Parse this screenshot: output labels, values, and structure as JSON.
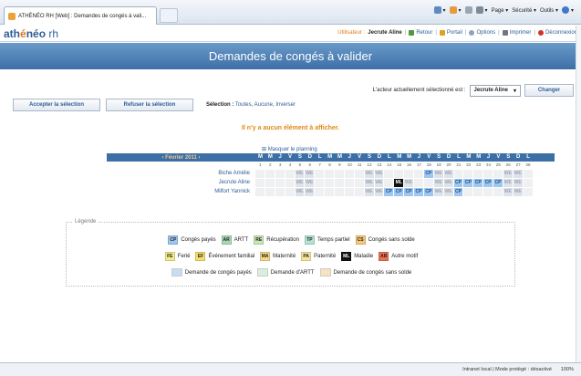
{
  "browser": {
    "tab_title": "ATHÉNÉO RH [Web] : Demandes de congés à vali...",
    "commands": [
      "Page ▾",
      "Sécurité ▾",
      "Outils ▾"
    ]
  },
  "header": {
    "logo_a": "ath",
    "logo_o": "é",
    "logo_b": "néo",
    "logo_rh": "rh",
    "user_label": "Utilisateur :",
    "user_name": "Jecrute Aline",
    "links": [
      "Retour",
      "Portail",
      "Options",
      "Imprimer",
      "Déconnexion"
    ]
  },
  "page": {
    "title": "Demandes de congés à valider",
    "actor_label": "L'acteur actuellement sélectionné est :",
    "actor_value": "Jecrute Aline",
    "change_label": "Changer",
    "accept_label": "Accepter la sélection",
    "refuse_label": "Refuser la sélection",
    "selection_label": "Sélection :",
    "selection_links": [
      "Toutes",
      "Aucune",
      "Inverser"
    ],
    "empty_message": "Il n'y a aucun élément à afficher.",
    "hide_planning": "⊞ Masquer le planning"
  },
  "planning": {
    "month": "‹ Février 2011 ›",
    "days_of_week": [
      "M",
      "M",
      "J",
      "V",
      "S",
      "D",
      "L",
      "M",
      "M",
      "J",
      "V",
      "S",
      "D",
      "L",
      "M",
      "M",
      "J",
      "V",
      "S",
      "D",
      "L",
      "M",
      "M",
      "J",
      "V",
      "S",
      "D",
      "L"
    ],
    "day_numbers": [
      "1",
      "2",
      "3",
      "4",
      "5",
      "6",
      "7",
      "8",
      "9",
      "10",
      "11",
      "12",
      "13",
      "14",
      "15",
      "16",
      "17",
      "18",
      "19",
      "20",
      "21",
      "22",
      "23",
      "24",
      "25",
      "26",
      "27",
      "28"
    ],
    "rows": [
      {
        "name": "Biche Amélie",
        "cells": [
          "",
          "",
          "",
          "",
          "WE",
          "WE",
          "",
          "",
          "",
          "",
          "",
          "WE",
          "WE",
          "",
          "",
          "",
          "",
          "CP",
          "WE",
          "WE",
          "",
          "",
          "",
          "",
          "",
          "WE",
          "WE",
          ""
        ]
      },
      {
        "name": "Jecrute Aline",
        "cells": [
          "",
          "",
          "",
          "",
          "WE",
          "WE",
          "",
          "",
          "",
          "",
          "",
          "WE",
          "WE",
          "",
          "ML",
          "WE",
          "",
          "",
          "WE",
          "WE",
          "CP",
          "CP",
          "CP",
          "CP",
          "CP",
          "WE",
          "WE",
          ""
        ]
      },
      {
        "name": "Milfort Yannick",
        "cells": [
          "",
          "",
          "",
          "",
          "WE",
          "WE",
          "",
          "",
          "",
          "",
          "",
          "WE",
          "WE",
          "CP",
          "CP",
          "CP",
          "CP",
          "CP",
          "WE",
          "WE",
          "CP",
          "",
          "",
          "",
          "",
          "WE",
          "WE",
          ""
        ]
      }
    ]
  },
  "legend": {
    "title": "Légende",
    "row1": [
      {
        "code": "CP",
        "label": "Congés payés",
        "color": "#9ec6ef"
      },
      {
        "code": "AR",
        "label": "ARTT",
        "color": "#a8d8b4"
      },
      {
        "code": "RE",
        "label": "Récupération",
        "color": "#c9e6b8"
      },
      {
        "code": "TP",
        "label": "Temps partiel",
        "color": "#b5e3d2"
      },
      {
        "code": "CS",
        "label": "Congés sans solde",
        "color": "#f5c77a"
      }
    ],
    "row2": [
      {
        "code": "FE",
        "label": "Ferié",
        "color": "#f3ea8a"
      },
      {
        "code": "EF",
        "label": "Événement familial",
        "color": "#f6dc6d"
      },
      {
        "code": "MA",
        "label": "Maternité",
        "color": "#f6d887"
      },
      {
        "code": "PA",
        "label": "Paternité",
        "color": "#f7e59b"
      },
      {
        "code": "ML",
        "label": "Maladie",
        "color": "#111111"
      },
      {
        "code": "AB",
        "label": "Autre motif",
        "color": "#e8734f"
      }
    ],
    "row3": [
      {
        "label": "Demande de congés payés",
        "color": "#c5ddf5"
      },
      {
        "label": "Demande d'ARTT",
        "color": "#d8eede"
      },
      {
        "label": "Demande de congés sans solde",
        "color": "#f8e2c0"
      }
    ]
  },
  "status": {
    "zone": "Intranet local | Mode protégé : désactivé",
    "zoom": "100%"
  }
}
